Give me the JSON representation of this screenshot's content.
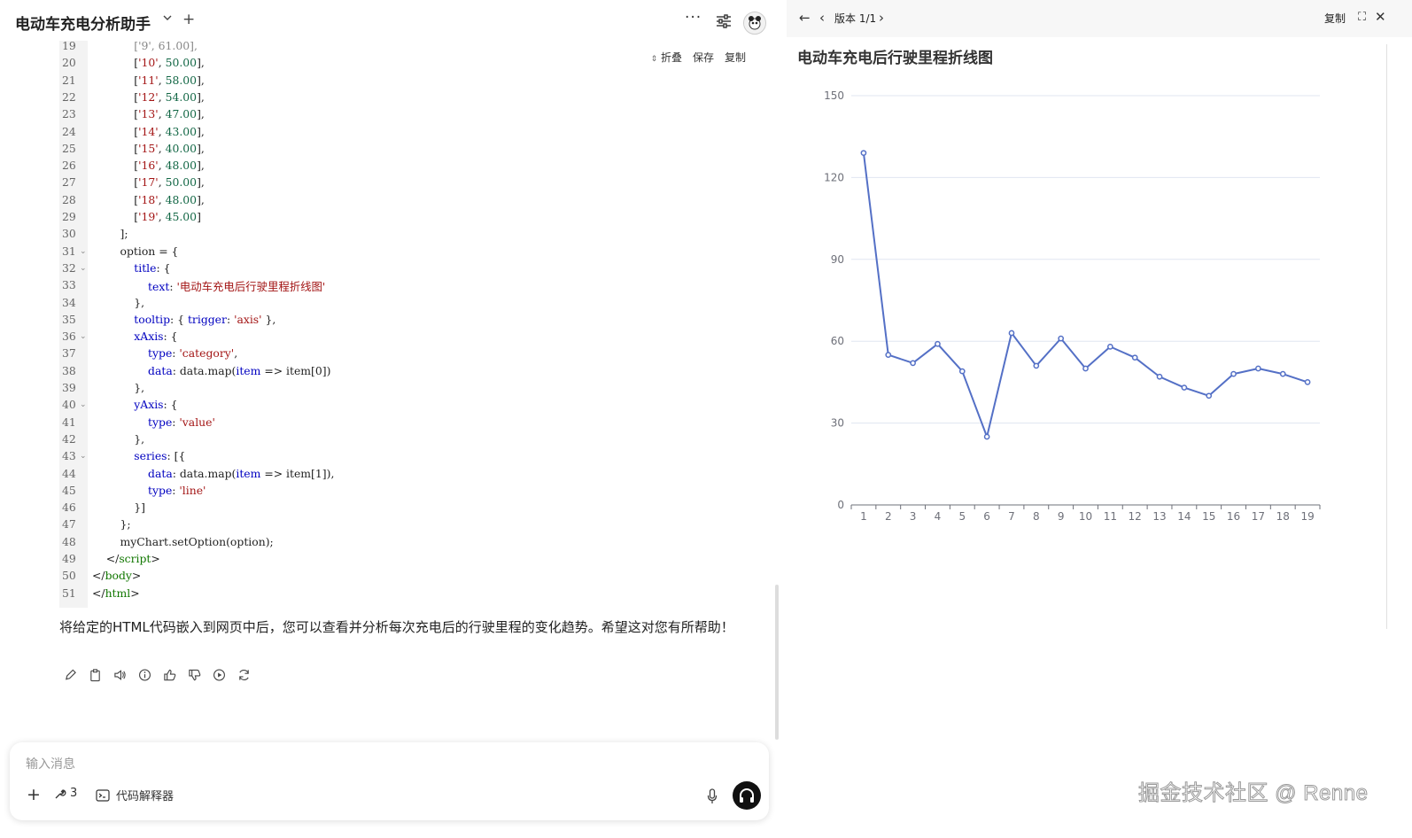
{
  "header": {
    "app_title": "电动车充电分析助手",
    "more_label": "···"
  },
  "code": {
    "tools": {
      "fold": "折叠",
      "save": "保存",
      "copy": "复制"
    },
    "lines": [
      {
        "n": "19",
        "fold": false,
        "parts": [
          [
            "g",
            "            ['9', 61.00],"
          ]
        ]
      },
      {
        "n": "20",
        "fold": false,
        "parts": [
          [
            "",
            "            ["
          ],
          [
            "s",
            "'10'"
          ],
          [
            "",
            ", "
          ],
          [
            "n",
            "50.00"
          ],
          [
            "",
            "],"
          ]
        ]
      },
      {
        "n": "21",
        "fold": false,
        "parts": [
          [
            "",
            "            ["
          ],
          [
            "s",
            "'11'"
          ],
          [
            "",
            ", "
          ],
          [
            "n",
            "58.00"
          ],
          [
            "",
            "],"
          ]
        ]
      },
      {
        "n": "22",
        "fold": false,
        "parts": [
          [
            "",
            "            ["
          ],
          [
            "s",
            "'12'"
          ],
          [
            "",
            ", "
          ],
          [
            "n",
            "54.00"
          ],
          [
            "",
            "],"
          ]
        ]
      },
      {
        "n": "23",
        "fold": false,
        "parts": [
          [
            "",
            "            ["
          ],
          [
            "s",
            "'13'"
          ],
          [
            "",
            ", "
          ],
          [
            "n",
            "47.00"
          ],
          [
            "",
            "],"
          ]
        ]
      },
      {
        "n": "24",
        "fold": false,
        "parts": [
          [
            "",
            "            ["
          ],
          [
            "s",
            "'14'"
          ],
          [
            "",
            ", "
          ],
          [
            "n",
            "43.00"
          ],
          [
            "",
            "],"
          ]
        ]
      },
      {
        "n": "25",
        "fold": false,
        "parts": [
          [
            "",
            "            ["
          ],
          [
            "s",
            "'15'"
          ],
          [
            "",
            ", "
          ],
          [
            "n",
            "40.00"
          ],
          [
            "",
            "],"
          ]
        ]
      },
      {
        "n": "26",
        "fold": false,
        "parts": [
          [
            "",
            "            ["
          ],
          [
            "s",
            "'16'"
          ],
          [
            "",
            ", "
          ],
          [
            "n",
            "48.00"
          ],
          [
            "",
            "],"
          ]
        ]
      },
      {
        "n": "27",
        "fold": false,
        "parts": [
          [
            "",
            "            ["
          ],
          [
            "s",
            "'17'"
          ],
          [
            "",
            ", "
          ],
          [
            "n",
            "50.00"
          ],
          [
            "",
            "],"
          ]
        ]
      },
      {
        "n": "28",
        "fold": false,
        "parts": [
          [
            "",
            "            ["
          ],
          [
            "s",
            "'18'"
          ],
          [
            "",
            ", "
          ],
          [
            "n",
            "48.00"
          ],
          [
            "",
            "],"
          ]
        ]
      },
      {
        "n": "29",
        "fold": false,
        "parts": [
          [
            "",
            "            ["
          ],
          [
            "s",
            "'19'"
          ],
          [
            "",
            ", "
          ],
          [
            "n",
            "45.00"
          ],
          [
            "",
            "]"
          ]
        ]
      },
      {
        "n": "30",
        "fold": false,
        "parts": [
          [
            "",
            "        ];"
          ]
        ]
      },
      {
        "n": "31",
        "fold": true,
        "parts": [
          [
            "",
            "        option = {"
          ]
        ]
      },
      {
        "n": "32",
        "fold": true,
        "parts": [
          [
            "",
            "            "
          ],
          [
            "k",
            "title"
          ],
          [
            "",
            ": {"
          ]
        ]
      },
      {
        "n": "33",
        "fold": false,
        "parts": [
          [
            "",
            "                "
          ],
          [
            "k",
            "text"
          ],
          [
            "",
            ": "
          ],
          [
            "s",
            "'电动车充电后行驶里程折线图'"
          ]
        ]
      },
      {
        "n": "34",
        "fold": false,
        "parts": [
          [
            "",
            "            },"
          ]
        ]
      },
      {
        "n": "35",
        "fold": false,
        "parts": [
          [
            "",
            "            "
          ],
          [
            "k",
            "tooltip"
          ],
          [
            "",
            ": { "
          ],
          [
            "k",
            "trigger"
          ],
          [
            "",
            ": "
          ],
          [
            "s",
            "'axis'"
          ],
          [
            "",
            " },"
          ]
        ]
      },
      {
        "n": "36",
        "fold": true,
        "parts": [
          [
            "",
            "            "
          ],
          [
            "k",
            "xAxis"
          ],
          [
            "",
            ": {"
          ]
        ]
      },
      {
        "n": "37",
        "fold": false,
        "parts": [
          [
            "",
            "                "
          ],
          [
            "k",
            "type"
          ],
          [
            "",
            ": "
          ],
          [
            "s",
            "'category'"
          ],
          [
            "",
            ","
          ]
        ]
      },
      {
        "n": "38",
        "fold": false,
        "parts": [
          [
            "",
            "                "
          ],
          [
            "k",
            "data"
          ],
          [
            "",
            ": data.map("
          ],
          [
            "k",
            "item"
          ],
          [
            "",
            " => item[0])"
          ]
        ]
      },
      {
        "n": "39",
        "fold": false,
        "parts": [
          [
            "",
            "            },"
          ]
        ]
      },
      {
        "n": "40",
        "fold": true,
        "parts": [
          [
            "",
            "            "
          ],
          [
            "k",
            "yAxis"
          ],
          [
            "",
            ": {"
          ]
        ]
      },
      {
        "n": "41",
        "fold": false,
        "parts": [
          [
            "",
            "                "
          ],
          [
            "k",
            "type"
          ],
          [
            "",
            ": "
          ],
          [
            "s",
            "'value'"
          ]
        ]
      },
      {
        "n": "42",
        "fold": false,
        "parts": [
          [
            "",
            "            },"
          ]
        ]
      },
      {
        "n": "43",
        "fold": true,
        "parts": [
          [
            "",
            "            "
          ],
          [
            "k",
            "series"
          ],
          [
            "",
            ": [{"
          ]
        ]
      },
      {
        "n": "44",
        "fold": false,
        "parts": [
          [
            "",
            "                "
          ],
          [
            "k",
            "data"
          ],
          [
            "",
            ": data.map("
          ],
          [
            "k",
            "item"
          ],
          [
            "",
            " => item[1]),"
          ]
        ]
      },
      {
        "n": "45",
        "fold": false,
        "parts": [
          [
            "",
            "                "
          ],
          [
            "k",
            "type"
          ],
          [
            "",
            ": "
          ],
          [
            "s",
            "'line'"
          ]
        ]
      },
      {
        "n": "46",
        "fold": false,
        "parts": [
          [
            "",
            "            }]"
          ]
        ]
      },
      {
        "n": "47",
        "fold": false,
        "parts": [
          [
            "",
            "        };"
          ]
        ]
      },
      {
        "n": "48",
        "fold": false,
        "parts": [
          [
            "",
            "        myChart.setOption(option);"
          ]
        ]
      },
      {
        "n": "49",
        "fold": false,
        "parts": [
          [
            "",
            "    </"
          ],
          [
            "t",
            "script"
          ],
          [
            "",
            ">"
          ]
        ]
      },
      {
        "n": "50",
        "fold": false,
        "parts": [
          [
            "",
            "</"
          ],
          [
            "t",
            "body"
          ],
          [
            "",
            ">"
          ]
        ]
      },
      {
        "n": "51",
        "fold": false,
        "parts": [
          [
            "",
            "</"
          ],
          [
            "t",
            "html"
          ],
          [
            "",
            ">"
          ]
        ]
      }
    ]
  },
  "message": {
    "text": "将给定的HTML代码嵌入到网页中后，您可以查看并分析每次充电后的行驶里程的变化趋势。希望这对您有所帮助！"
  },
  "input": {
    "placeholder": "输入消息",
    "tool_count": "3",
    "code_interpreter_label": "代码解释器"
  },
  "preview": {
    "version_label": "版本 1/1",
    "copy_label": "复制"
  },
  "watermark": "掘金技术社区 @ Renne",
  "colors": {
    "line": "#5470c6",
    "grid": "#e0e6f1",
    "axis": "#6e7079"
  },
  "chart_data": {
    "type": "line",
    "title": "电动车充电后行驶里程折线图",
    "categories": [
      "1",
      "2",
      "3",
      "4",
      "5",
      "6",
      "7",
      "8",
      "9",
      "10",
      "11",
      "12",
      "13",
      "14",
      "15",
      "16",
      "17",
      "18",
      "19"
    ],
    "series": [
      {
        "values": [
          129,
          55,
          52,
          59,
          49,
          25,
          63,
          51,
          61,
          50,
          58,
          54,
          47,
          43,
          40,
          48,
          50,
          48,
          45
        ]
      }
    ],
    "ylim": [
      0,
      150
    ],
    "yticks": [
      0,
      30,
      60,
      90,
      120,
      150
    ],
    "grid": true
  }
}
